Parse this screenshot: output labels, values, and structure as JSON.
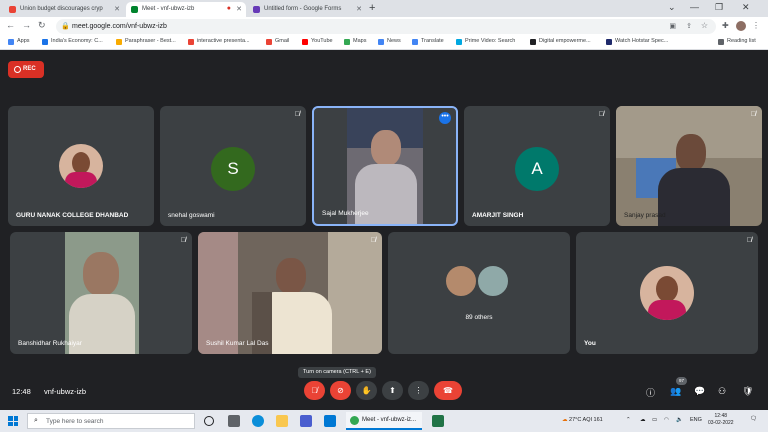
{
  "browser": {
    "tabs": [
      {
        "title": "Union budget discourages cryp",
        "favicon_color": "#ea4335"
      },
      {
        "title": "Meet - vnf-ubwz-izb",
        "favicon_color": "#00832d",
        "extra_icon": "recording-dot"
      },
      {
        "title": "Untitled form - Google Forms",
        "favicon_color": "#673ab7"
      }
    ],
    "new_tab_label": "+",
    "window_controls": [
      "⌄",
      "—",
      "❐",
      "✕"
    ],
    "url": "meet.google.com/vnf-ubwz-izb",
    "bookmarks": [
      {
        "label": "Apps",
        "color": "#4285f4"
      },
      {
        "label": "India's Economy: C...",
        "color": "#1a73e8"
      },
      {
        "label": "Paraphraser - Best...",
        "color": "#f9ab00"
      },
      {
        "label": "interactive presenta...",
        "color": "#ea4335"
      },
      {
        "label": "Gmail",
        "color": "#ea4335"
      },
      {
        "label": "YouTube",
        "color": "#ff0000"
      },
      {
        "label": "Maps",
        "color": "#34a853"
      },
      {
        "label": "News",
        "color": "#4285f4"
      },
      {
        "label": "Translate",
        "color": "#4285f4"
      },
      {
        "label": "Prime Video: Search",
        "color": "#00a8e1"
      },
      {
        "label": "Digital empowerme...",
        "color": "#202124"
      },
      {
        "label": "Watch Hotstar Spec...",
        "color": "#1f2a6b"
      }
    ],
    "reading_list": "Reading list"
  },
  "meet": {
    "rec_label": "REC",
    "participants": [
      {
        "name": "GURU NANAK COLLEGE DHANBAD",
        "kind": "photo-avatar",
        "muted": false
      },
      {
        "name": "snehal goswami",
        "kind": "letter",
        "letter": "S",
        "color": "#33691e",
        "muted": true
      },
      {
        "name": "Sajal Mukherjee",
        "kind": "video",
        "muted": false,
        "active": true
      },
      {
        "name": "AMARJIT SINGH",
        "kind": "letter",
        "letter": "A",
        "color": "#00796b",
        "muted": true
      },
      {
        "name": "Sanjay prasad",
        "kind": "video",
        "muted": true
      },
      {
        "name": "Banshidhar Rukhaiyar",
        "kind": "video",
        "muted": true
      },
      {
        "name": "Sushil Kumar Lal Das",
        "kind": "video",
        "muted": true
      },
      {
        "name": "89 others",
        "kind": "others",
        "muted": false
      },
      {
        "name": "You",
        "kind": "photo-avatar",
        "muted": true
      }
    ],
    "tooltip": "Turn on camera (CTRL + E)",
    "time": "12:48",
    "meeting_code": "vnf-ubwz-izb",
    "participant_count": "97",
    "accent_red": "#ea4335"
  },
  "taskbar": {
    "search_placeholder": "Type here to search",
    "active_app": "Meet - vnf-ubwz-iz...",
    "weather": "27°C AQI 161",
    "language": "ENG",
    "clock_time": "12:48",
    "clock_date": "03-02-2022"
  }
}
